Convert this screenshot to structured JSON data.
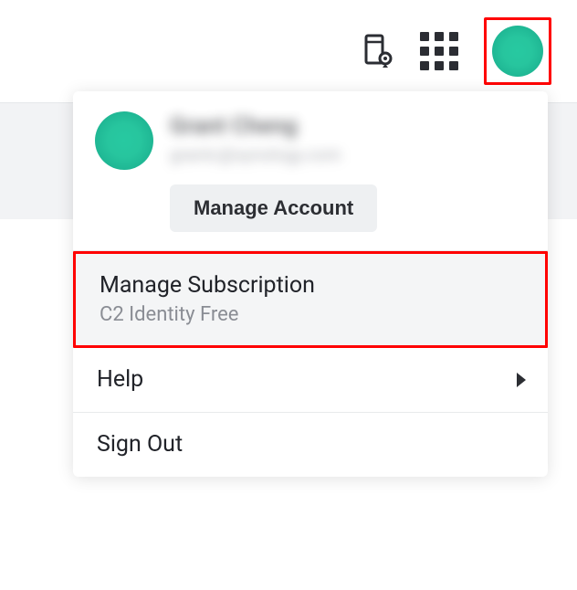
{
  "topbar": {
    "location_icon": "device-location-icon",
    "apps_icon": "apps-grid-icon",
    "avatar_icon": "user-avatar"
  },
  "menu": {
    "user": {
      "name": "Grant Cheng",
      "email": "grantc@synology.com"
    },
    "manage_account_label": "Manage Account",
    "items": [
      {
        "label": "Manage Subscription",
        "subtext": "C2 Identity Free",
        "highlighted": true
      },
      {
        "label": "Help",
        "has_submenu": true
      },
      {
        "label": "Sign Out"
      }
    ]
  },
  "colors": {
    "accent": "#20bd97",
    "highlight_border": "#ff0000"
  }
}
